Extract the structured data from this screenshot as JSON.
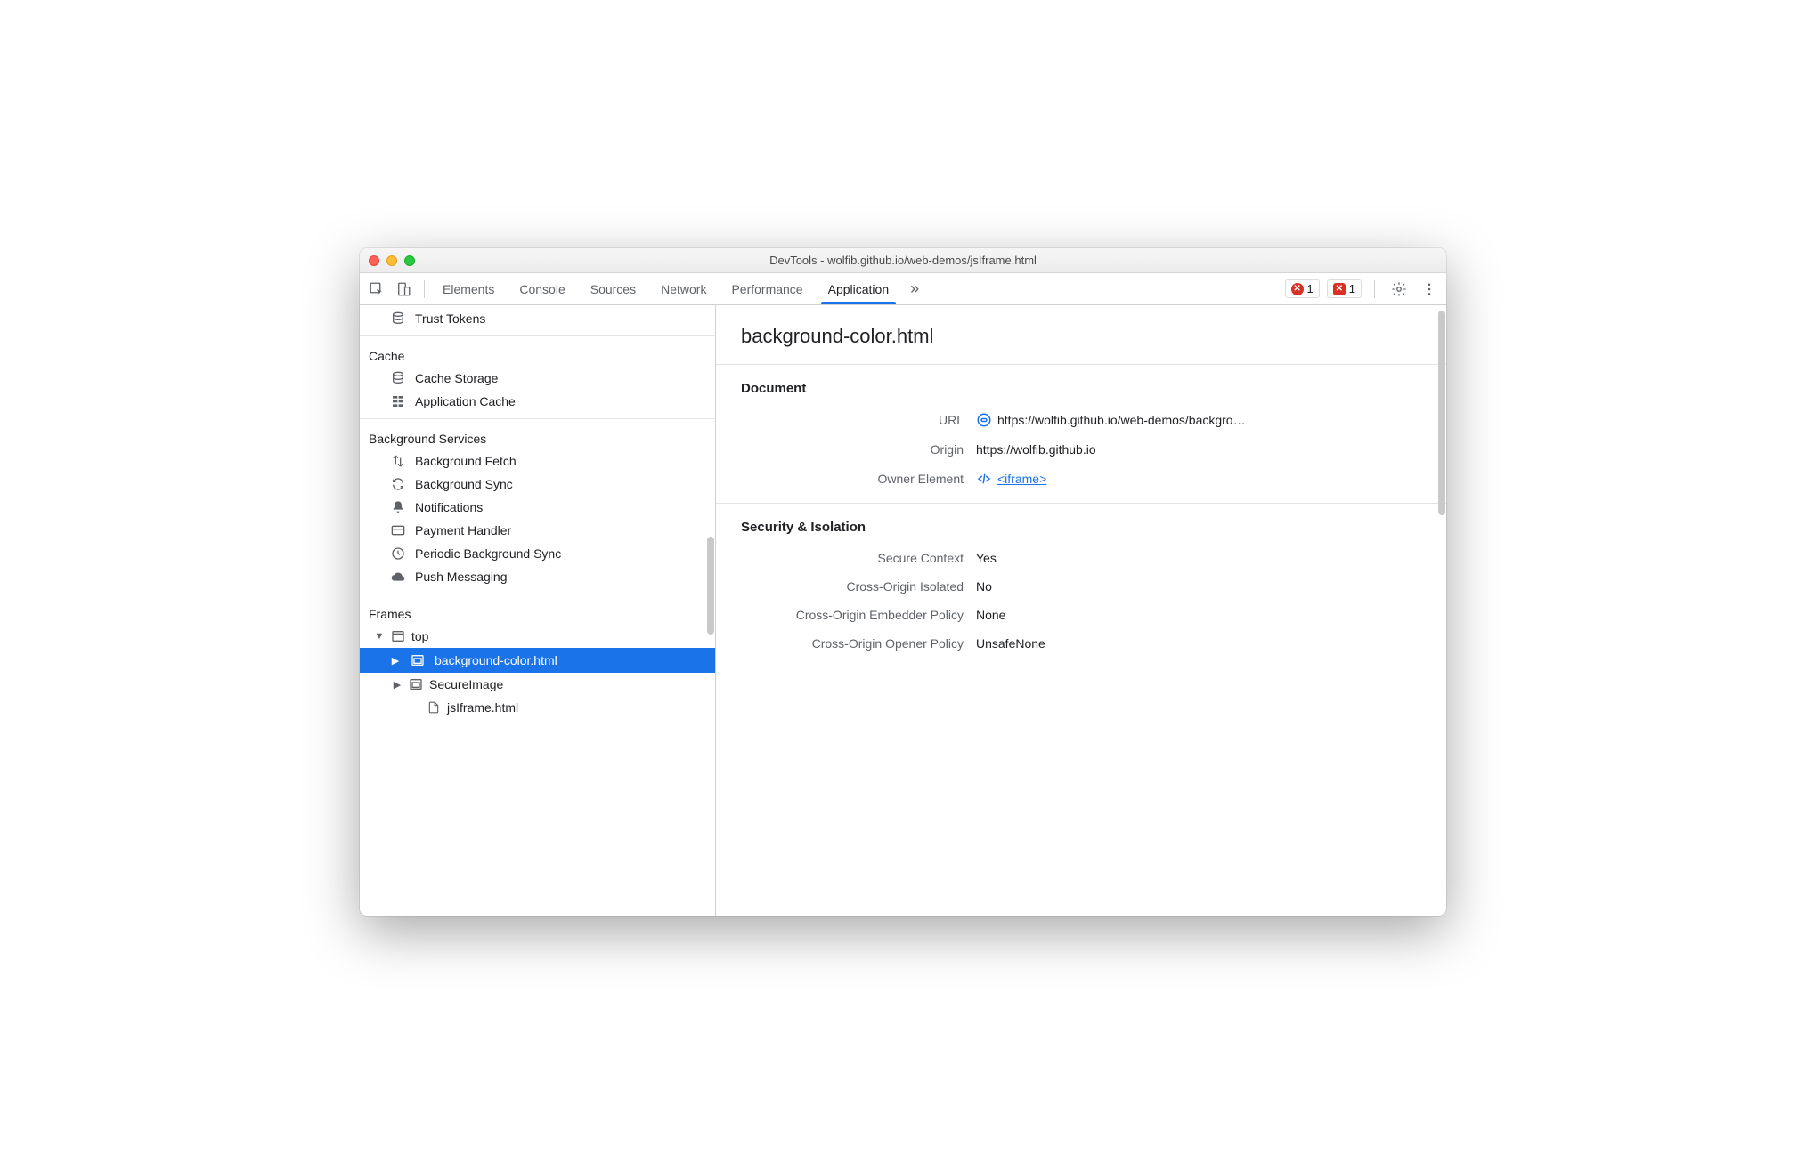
{
  "window": {
    "title": "DevTools - wolfib.github.io/web-demos/jsIframe.html"
  },
  "tabs": {
    "items": [
      "Elements",
      "Console",
      "Sources",
      "Network",
      "Performance",
      "Application"
    ],
    "active": 5,
    "overflow": "»"
  },
  "badges": {
    "errors": "1",
    "issues": "1"
  },
  "sidebar": {
    "trustTokens": "Trust Tokens",
    "cache": {
      "title": "Cache",
      "items": [
        "Cache Storage",
        "Application Cache"
      ]
    },
    "backgroundServices": {
      "title": "Background Services",
      "items": [
        "Background Fetch",
        "Background Sync",
        "Notifications",
        "Payment Handler",
        "Periodic Background Sync",
        "Push Messaging"
      ]
    },
    "frames": {
      "title": "Frames",
      "top": "top",
      "children": [
        {
          "label": "background-color.html",
          "selected": true,
          "hasChildren": true
        },
        {
          "label": "SecureImage",
          "selected": false,
          "hasChildren": true
        },
        {
          "label": "jsIframe.html",
          "selected": false,
          "hasChildren": false
        }
      ]
    }
  },
  "main": {
    "title": "background-color.html",
    "document": {
      "heading": "Document",
      "url_label": "URL",
      "url_value": "https://wolfib.github.io/web-demos/backgro…",
      "origin_label": "Origin",
      "origin_value": "https://wolfib.github.io",
      "owner_label": "Owner Element",
      "owner_value": " <iframe>"
    },
    "security": {
      "heading": "Security & Isolation",
      "rows": [
        {
          "k": "Secure Context",
          "v": "Yes"
        },
        {
          "k": "Cross-Origin Isolated",
          "v": "No"
        },
        {
          "k": "Cross-Origin Embedder Policy",
          "v": "None"
        },
        {
          "k": "Cross-Origin Opener Policy",
          "v": "UnsafeNone"
        }
      ]
    }
  }
}
